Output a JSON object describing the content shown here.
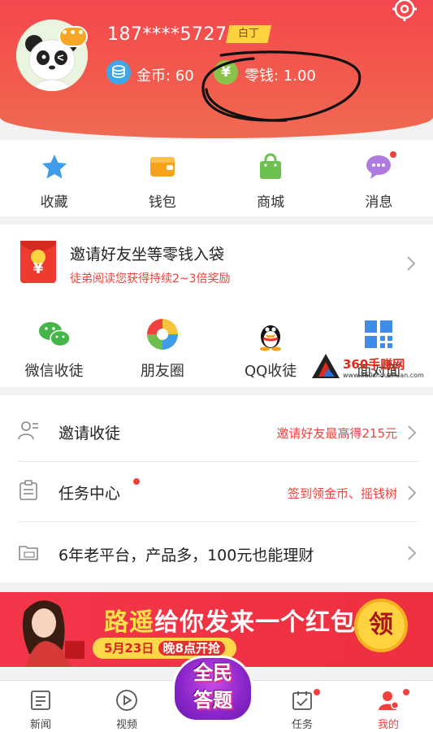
{
  "profile": {
    "phone": "187****5727",
    "level_badge": "白丁",
    "coins_label": "金币: 60",
    "change_label": "零钱: 1.00",
    "avatar_bubble": "•••",
    "colors": {
      "header": "#f5474e",
      "badge": "#ffd23f",
      "coin": "#3fa6e8",
      "yuan": "#8bc34a"
    }
  },
  "quick_nav": [
    {
      "label": "收藏",
      "icon": "star-icon"
    },
    {
      "label": "钱包",
      "icon": "wallet-icon"
    },
    {
      "label": "商城",
      "icon": "shopping-bag-icon"
    },
    {
      "label": "消息",
      "icon": "message-icon",
      "dot": true
    }
  ],
  "invite": {
    "title": "邀请好友坐等零钱入袋",
    "subtitle": "徒弟阅读您获得持续2~3倍奖励",
    "hongbao_symbol": "¥"
  },
  "share": [
    {
      "label": "微信收徒",
      "icon": "wechat-icon"
    },
    {
      "label": "朋友圈",
      "icon": "moments-icon"
    },
    {
      "label": "QQ收徒",
      "icon": "qq-icon"
    },
    {
      "label": "面对面",
      "icon": "qr-code-icon"
    }
  ],
  "watermark": {
    "name": "360手赚网",
    "url": "www.360shouzhuan.com"
  },
  "menu": [
    {
      "title": "邀请收徒",
      "hint": "邀请好友最高得215元",
      "icon": "user-icon"
    },
    {
      "title": "任务中心",
      "hint": "签到领金币、摇钱树",
      "icon": "task-icon",
      "dot": true
    },
    {
      "title": "6年老平台，产品多，100元也能理财",
      "hint": "",
      "icon": "ad-folder-icon"
    }
  ],
  "banner": {
    "name_highlight": "路遥",
    "title_rest": "给你发来一个红包",
    "date": "5月23日",
    "time": "晚8点开抢",
    "button": "领"
  },
  "tabs": [
    {
      "label": "新闻",
      "icon": "news-icon"
    },
    {
      "label": "视频",
      "icon": "video-icon"
    },
    {
      "label": "任务",
      "icon": "task-tab-icon",
      "dot": true
    },
    {
      "label": "我的",
      "icon": "profile-icon",
      "active": true,
      "dot": true
    }
  ],
  "quiz": {
    "line1": "全民",
    "line2": "答题"
  }
}
